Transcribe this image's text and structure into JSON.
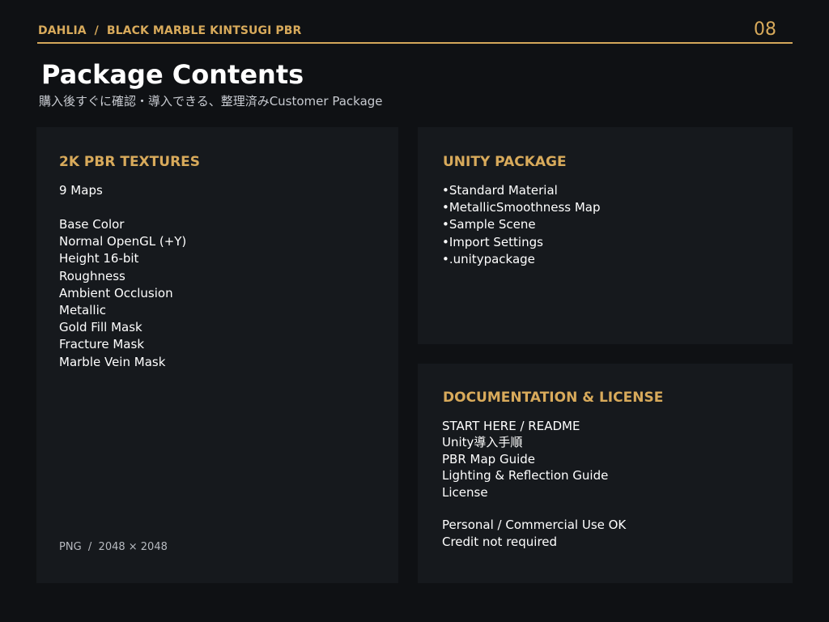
{
  "header": {
    "breadcrumb": "DAHLIA  /  BLACK MARBLE KINTSUGI PBR",
    "page_number": "08"
  },
  "title": "Package Contents",
  "subtitle": "購入後すぐに確認・導入できる、整理済みCustomer Package",
  "textures": {
    "heading": "2K PBR TEXTURES",
    "count": "9 Maps",
    "items": [
      "Base Color",
      "Normal OpenGL (+Y)",
      "Height 16-bit",
      "Roughness",
      "Ambient Occlusion",
      "Metallic",
      "Gold Fill Mask",
      "Fracture Mask",
      "Marble Vein Mask"
    ],
    "footer": "PNG  /  2048 × 2048"
  },
  "unity": {
    "heading": "UNITY PACKAGE",
    "items": [
      "Standard Material",
      "MetallicSmoothness Map",
      "Sample Scene",
      "Import Settings",
      ".unitypackage"
    ]
  },
  "docs": {
    "heading": "DOCUMENTATION & LICENSE",
    "items": [
      "START HERE / README",
      "Unity導入手順",
      "PBR Map Guide",
      "Lighting & Reflection Guide",
      "License"
    ],
    "license": [
      "Personal / Commercial Use OK",
      "Credit not required"
    ]
  },
  "colors": {
    "accent_gold": "#d8aa5b",
    "background": "#0f1114",
    "panel": "#16191d"
  }
}
